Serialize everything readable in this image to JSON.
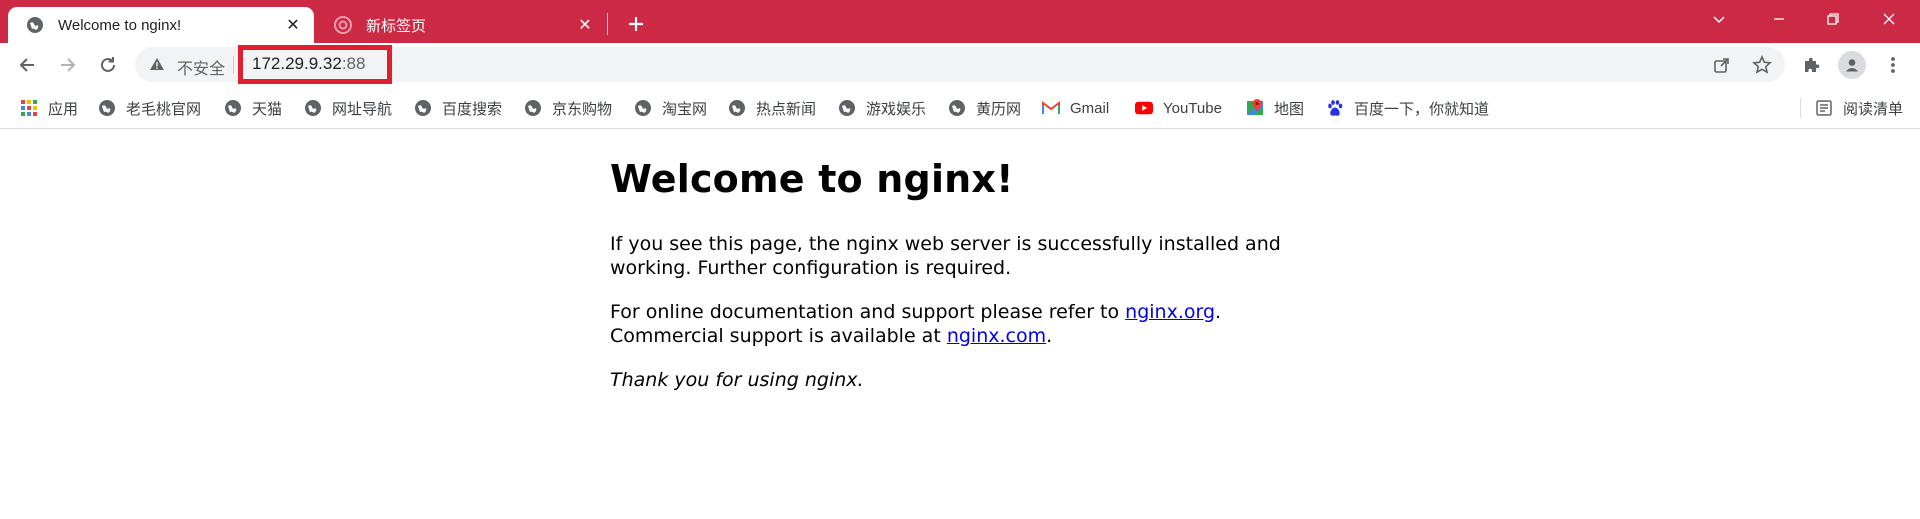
{
  "tabs": [
    {
      "title": "Welcome to nginx!",
      "active": true
    },
    {
      "title": "新标签页",
      "active": false
    }
  ],
  "window_controls": [
    "tab-search",
    "minimize",
    "restore",
    "close"
  ],
  "toolbar": {
    "security_label": "不安全",
    "url_host": "172.29.9.32",
    "url_port": ":88"
  },
  "bookmarks": [
    {
      "label": "应用",
      "icon": "apps-grid-icon"
    },
    {
      "label": "老毛桃官网",
      "icon": "globe-icon"
    },
    {
      "label": "天猫",
      "icon": "globe-icon"
    },
    {
      "label": "网址导航",
      "icon": "globe-icon"
    },
    {
      "label": "百度搜索",
      "icon": "globe-icon"
    },
    {
      "label": "京东购物",
      "icon": "globe-icon"
    },
    {
      "label": "淘宝网",
      "icon": "globe-icon"
    },
    {
      "label": "热点新闻",
      "icon": "globe-icon"
    },
    {
      "label": "游戏娱乐",
      "icon": "globe-icon"
    },
    {
      "label": "黄历网",
      "icon": "globe-icon"
    },
    {
      "label": "Gmail",
      "icon": "gmail-icon"
    },
    {
      "label": "YouTube",
      "icon": "youtube-icon"
    },
    {
      "label": "地图",
      "icon": "maps-icon"
    },
    {
      "label": "百度一下，你就知道",
      "icon": "baidu-paw-icon"
    }
  ],
  "reading_list": {
    "label": "阅读清单"
  },
  "page": {
    "heading": "Welcome to nginx!",
    "para1_line1": "If you see this page, the nginx web server is successfully installed and",
    "para1_line2": "working. Further configuration is required.",
    "para2_line1_prefix": "For online documentation and support please refer to ",
    "para2_link1": "nginx.org",
    "para2_line1_suffix": ".",
    "para2_line2_prefix": "Commercial support is available at ",
    "para2_link2": "nginx.com",
    "para2_line2_suffix": ".",
    "thanks": "Thank you for using nginx."
  },
  "colors": {
    "tabstrip": "#cc2945",
    "highlight": "#e0202e",
    "link": "#0000ee"
  }
}
